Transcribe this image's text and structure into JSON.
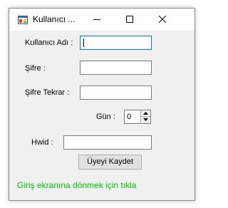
{
  "window": {
    "title": "Kullanıcı ...",
    "icon": "app-window-icon"
  },
  "form": {
    "username_label": "Kullanıcı Adı :",
    "username_value": "",
    "password_label": "Şifre :",
    "password_value": "",
    "password_repeat_label": "Şifre Tekrar :",
    "password_repeat_value": "",
    "day_label": "Gün :",
    "day_value": "0",
    "hwid_label": "Hwid :",
    "hwid_value": "",
    "register_button": "Üyeyi Kaydet",
    "login_link": "Giriş ekranına dönmek için tıkla"
  },
  "colors": {
    "link": "#00c000",
    "focus_border": "#0078d7"
  }
}
